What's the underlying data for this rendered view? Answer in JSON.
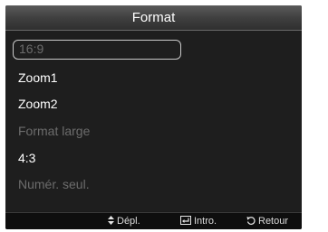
{
  "title": "Format",
  "items": [
    {
      "label": "16:9",
      "state": "disabled-selected"
    },
    {
      "label": "Zoom1",
      "state": "enabled"
    },
    {
      "label": "Zoom2",
      "state": "enabled"
    },
    {
      "label": "Format large",
      "state": "disabled"
    },
    {
      "label": "4:3",
      "state": "enabled"
    },
    {
      "label": "Numér. seul.",
      "state": "disabled"
    }
  ],
  "footer": {
    "move_icon": "updown-icon",
    "move_label": "Dépl.",
    "enter_icon": "enter-icon",
    "enter_label": "Intro.",
    "return_icon": "return-icon",
    "return_label": "Retour"
  },
  "colors": {
    "background": "#1e1e1e",
    "text": "#ffffff",
    "disabled_text": "#6c6c6c",
    "selection_border": "#c9c9c9"
  }
}
